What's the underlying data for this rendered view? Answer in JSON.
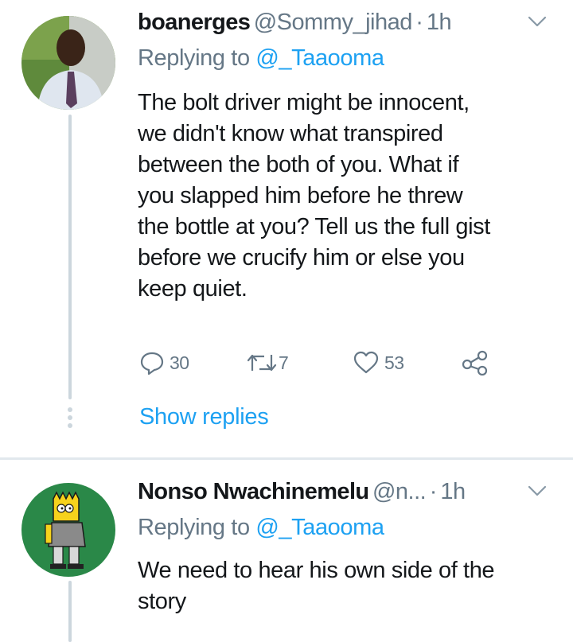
{
  "tweets": [
    {
      "display_name": "boanerges",
      "handle": "@Sommy_jihad",
      "separator": "·",
      "time": "1h",
      "replying_prefix": "Replying to ",
      "replying_to": "@_Taaooma",
      "text_lines": [
        "The bolt driver might be innocent,",
        "we didn't know what transpired",
        "between the both of you. What if",
        "you slapped him before he threw",
        "the bottle at you? Tell us the full gist",
        "before we crucify him or else you",
        "keep quiet."
      ],
      "replies_count": "30",
      "retweets_count": "7",
      "likes_count": "53",
      "show_replies_label": "Show replies"
    },
    {
      "display_name": "Nonso Nwachinemelu",
      "handle": "@n...",
      "separator": "·",
      "time": "1h",
      "replying_prefix": "Replying to ",
      "replying_to": "@_Taaooma",
      "text_lines": [
        "We need to hear his own side of the",
        "story"
      ]
    }
  ],
  "colors": {
    "link": "#1da1f2",
    "secondary_text": "#657786",
    "divider": "#e1e8ed"
  },
  "icons": [
    "reply-icon",
    "retweet-icon",
    "like-icon",
    "share-icon",
    "chevron-down-icon"
  ]
}
